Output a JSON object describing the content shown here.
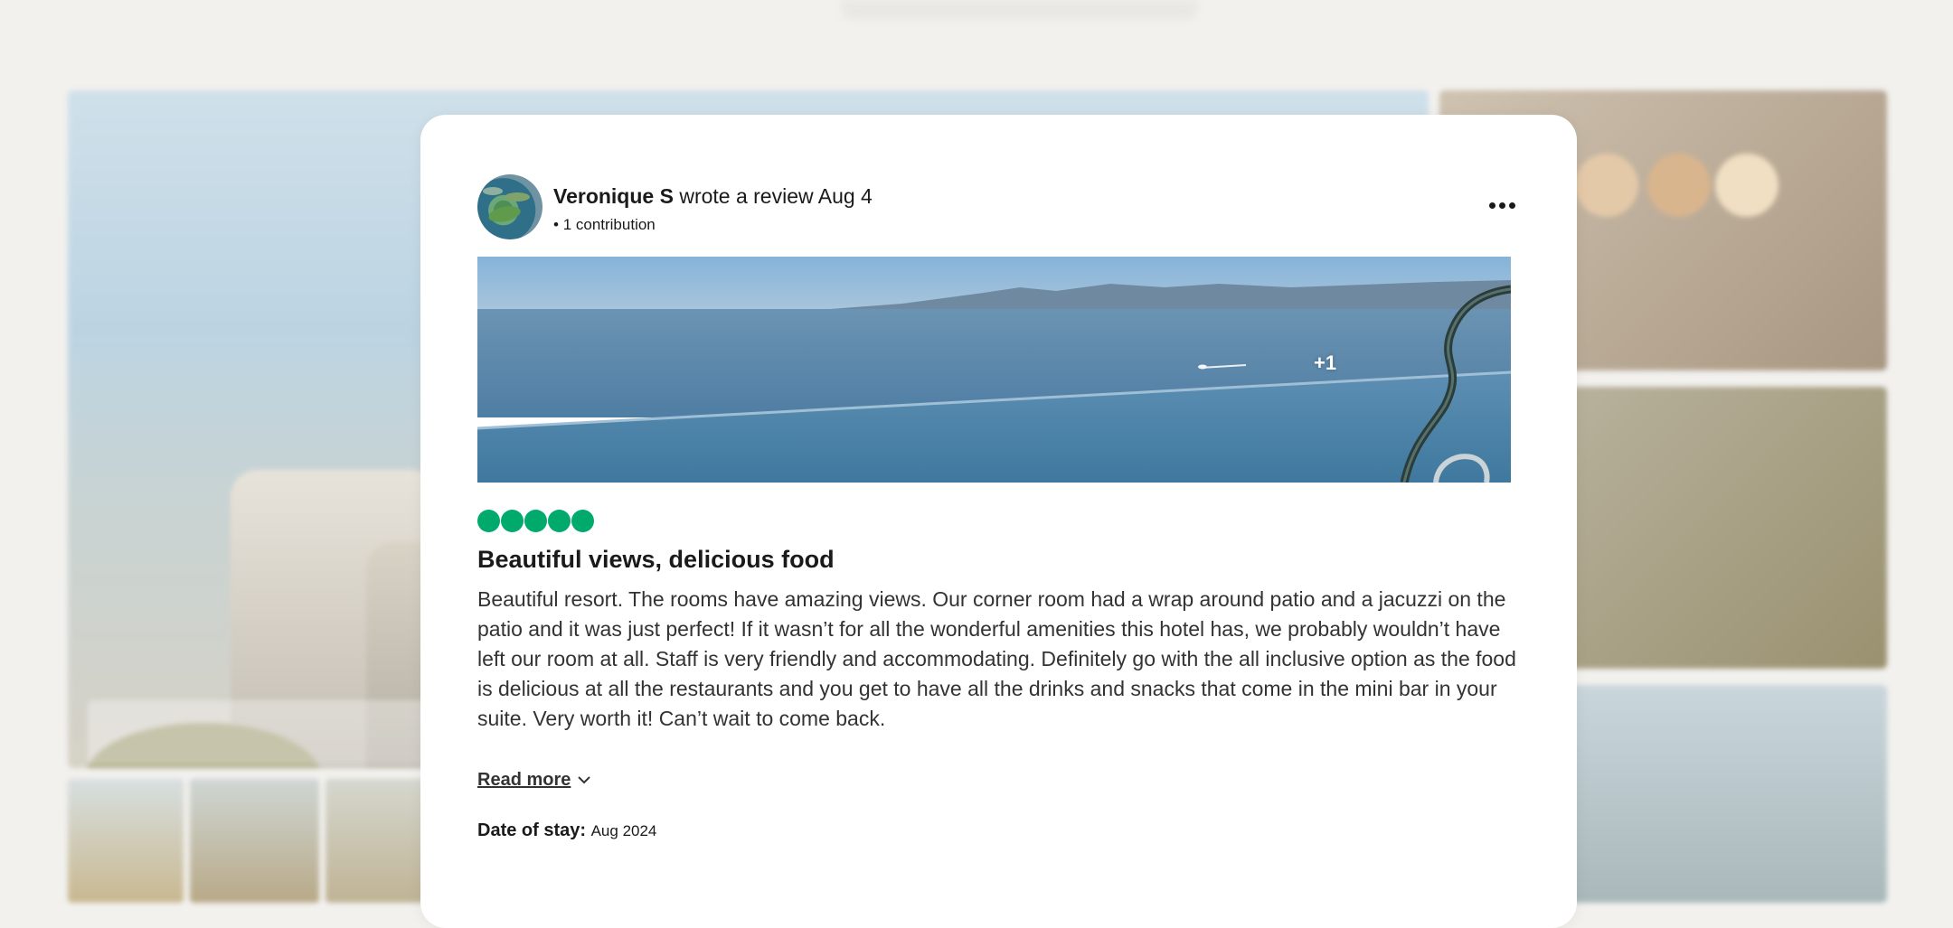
{
  "review": {
    "reviewer_name": "Veronique S",
    "action_text": " wrote a review Aug 4",
    "contribution_bullet": "•",
    "contributions": "1 contribution",
    "more_options_icon": "more-horizontal-icon",
    "photo_extra_count": "+1",
    "rating_bubbles": 5,
    "rating_max": 5,
    "rating_color": "#00aa6c",
    "title": "Beautiful views, delicious food",
    "body": "Beautiful resort. The rooms have amazing views. Our corner room had a wrap around patio and a jacuzzi on the patio and it was just perfect! If it wasn’t for all the wonderful amenities this hotel has, we probably wouldn’t have left our room at all. Staff is very friendly and accommodating. Definitely go with the all inclusive option as the food is delicious at all the restaurants and you get to have all the drinks and snacks that come in the mini bar in your suite. Very worth it! Can’t wait to come back.",
    "read_more_label": "Read more",
    "read_more_icon": "chevron-down-icon",
    "date_of_stay_label": "Date of stay:",
    "date_of_stay_value": "Aug 2024"
  },
  "colors": {
    "page_background": "#f2f1ee",
    "card_background": "#ffffff",
    "text_primary": "#1a1a1a",
    "text_body": "#333333"
  }
}
